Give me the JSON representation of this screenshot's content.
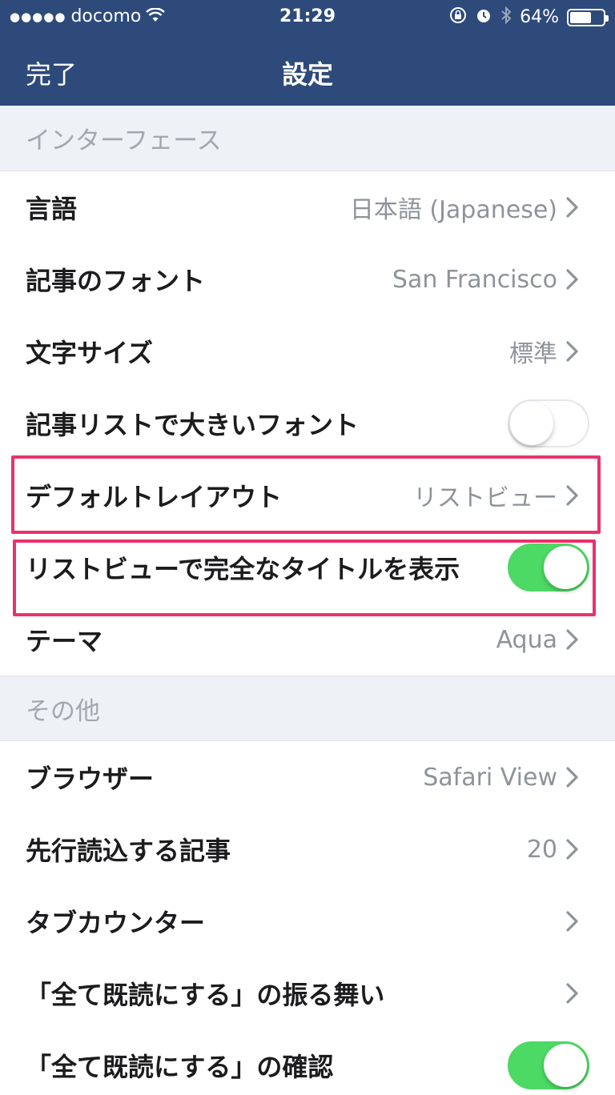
{
  "status_bar": {
    "signal": "●●●●●",
    "carrier": "docomo",
    "wifi_icon": "wifi-icon",
    "time": "21:29",
    "battery_percent": "64%",
    "battery_level": 0.64
  },
  "nav": {
    "done_label": "完了",
    "title": "設定"
  },
  "sections": [
    {
      "header": "インターフェース",
      "rows": [
        {
          "label": "言語",
          "value": "日本語 (Japanese)",
          "accessory": "chevron"
        },
        {
          "label": "記事のフォント",
          "value": "San Francisco",
          "accessory": "chevron"
        },
        {
          "label": "文字サイズ",
          "value": "標準",
          "accessory": "chevron"
        },
        {
          "label": "記事リストで大きいフォント",
          "accessory": "toggle",
          "on": false
        },
        {
          "label": "デフォルトレイアウト",
          "value": "リストビュー",
          "accessory": "chevron",
          "highlighted": true
        },
        {
          "label": "リストビューで完全なタイトルを表示",
          "accessory": "toggle",
          "on": true,
          "highlighted": true
        },
        {
          "label": "テーマ",
          "value": "Aqua",
          "accessory": "chevron"
        }
      ]
    },
    {
      "header": "その他",
      "rows": [
        {
          "label": "ブラウザー",
          "value": "Safari View",
          "accessory": "chevron"
        },
        {
          "label": "先行読込する記事",
          "value": "20",
          "accessory": "chevron"
        },
        {
          "label": "タブカウンター",
          "value": "",
          "accessory": "chevron"
        },
        {
          "label": "「全て既読にする」の振る舞い",
          "value": "",
          "accessory": "chevron"
        },
        {
          "label": "「全て既読にする」の確認",
          "accessory": "toggle",
          "on": true
        }
      ]
    }
  ],
  "colors": {
    "nav_background": "#2d4a7b",
    "toggle_on": "#4cd964",
    "highlight_border": "#e8336c",
    "section_background": "#eef1f6"
  }
}
